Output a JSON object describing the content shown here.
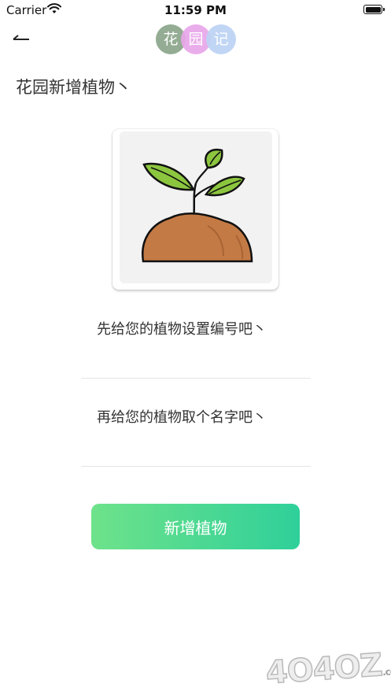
{
  "status_bar": {
    "carrier": "Carrier",
    "time": "11:59 PM",
    "icons": [
      "wifi-icon",
      "battery-icon"
    ]
  },
  "nav": {
    "back_icon": "back-arrow-icon",
    "logo": [
      {
        "char": "花",
        "color": "#8aa68a"
      },
      {
        "char": "园",
        "color": "#e9a7ea"
      },
      {
        "char": "记",
        "color": "#bcd3f5"
      }
    ]
  },
  "page": {
    "title": "花园新增植物丶"
  },
  "plant_image": {
    "icon": "sprout-in-soil-icon",
    "colors": {
      "leaf": "#8cc63f",
      "soil": "#c47a45"
    }
  },
  "form": {
    "number_placeholder": "先给您的植物设置编号吧丶",
    "number_value": "",
    "name_placeholder": "再给您的植物取个名字吧丶",
    "name_value": "",
    "submit_label": "新增植物"
  },
  "watermark": {
    "text": "4O4OZ",
    "suffix": ".com"
  },
  "colors": {
    "button_gradient_start": "#6ee28a",
    "button_gradient_end": "#2fd09a"
  }
}
